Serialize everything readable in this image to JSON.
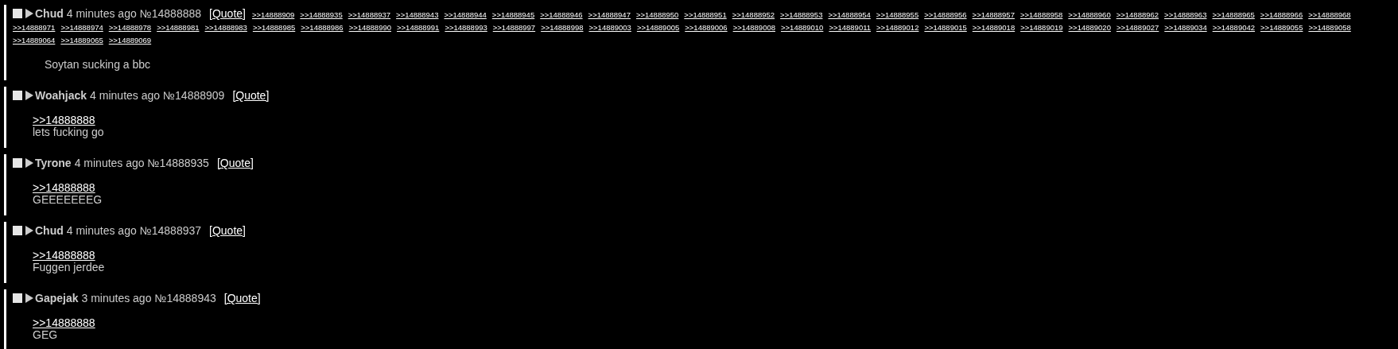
{
  "posts": [
    {
      "checked": false,
      "name": "Chud",
      "time": "4 minutes ago",
      "number": "№14888888",
      "quote": "[Quote]",
      "backlinks": [
        ">>14888909",
        ">>14888935",
        ">>14888937",
        ">>14888943",
        ">>14888944",
        ">>14888945",
        ">>14888946",
        ">>14888947",
        ">>14888950",
        ">>14888951",
        ">>14888952",
        ">>14888953",
        ">>14888954",
        ">>14888955",
        ">>14888956",
        ">>14888957",
        ">>14888958",
        ">>14888960",
        ">>14888962",
        ">>14888963",
        ">>14888965",
        ">>14888966",
        ">>14888968",
        ">>14888971",
        ">>14888974",
        ">>14888978",
        ">>14888981",
        ">>14888983",
        ">>14888985",
        ">>14888986",
        ">>14888990",
        ">>14888991",
        ">>14888993",
        ">>14888997",
        ">>14888998",
        ">>14889003",
        ">>14889005",
        ">>14889006",
        ">>14889008",
        ">>14889010",
        ">>14889011",
        ">>14889012",
        ">>14889015",
        ">>14889018",
        ">>14889019",
        ">>14889020",
        ">>14889027",
        ">>14889034",
        ">>14889042",
        ">>14889055",
        ">>14889058",
        ">>14889064",
        ">>14889065",
        ">>14889069"
      ],
      "body": [
        {
          "kind": "text",
          "text": "Soytan sucking a bbc"
        }
      ]
    },
    {
      "checked": false,
      "name": "Woahjack",
      "time": "4 minutes ago",
      "number": "№14888909",
      "quote": "[Quote]",
      "body": [
        {
          "kind": "quotelink",
          "text": ">>14888888"
        },
        {
          "kind": "text",
          "text": "lets fucking go"
        }
      ]
    },
    {
      "checked": false,
      "name": "Tyrone",
      "time": "4 minutes ago",
      "number": "№14888935",
      "quote": "[Quote]",
      "body": [
        {
          "kind": "quotelink",
          "text": ">>14888888"
        },
        {
          "kind": "text",
          "text": "GEEEEEEEG"
        }
      ]
    },
    {
      "checked": false,
      "name": "Chud",
      "time": "4 minutes ago",
      "number": "№14888937",
      "quote": "[Quote]",
      "body": [
        {
          "kind": "quotelink",
          "text": ">>14888888"
        },
        {
          "kind": "text",
          "text": "Fuggen jerdee"
        }
      ]
    },
    {
      "checked": false,
      "name": "Gapejak",
      "time": "3 minutes ago",
      "number": "№14888943",
      "quote": "[Quote]",
      "body": [
        {
          "kind": "quotelink",
          "text": ">>14888888"
        },
        {
          "kind": "text",
          "text": "GEG"
        }
      ]
    }
  ]
}
